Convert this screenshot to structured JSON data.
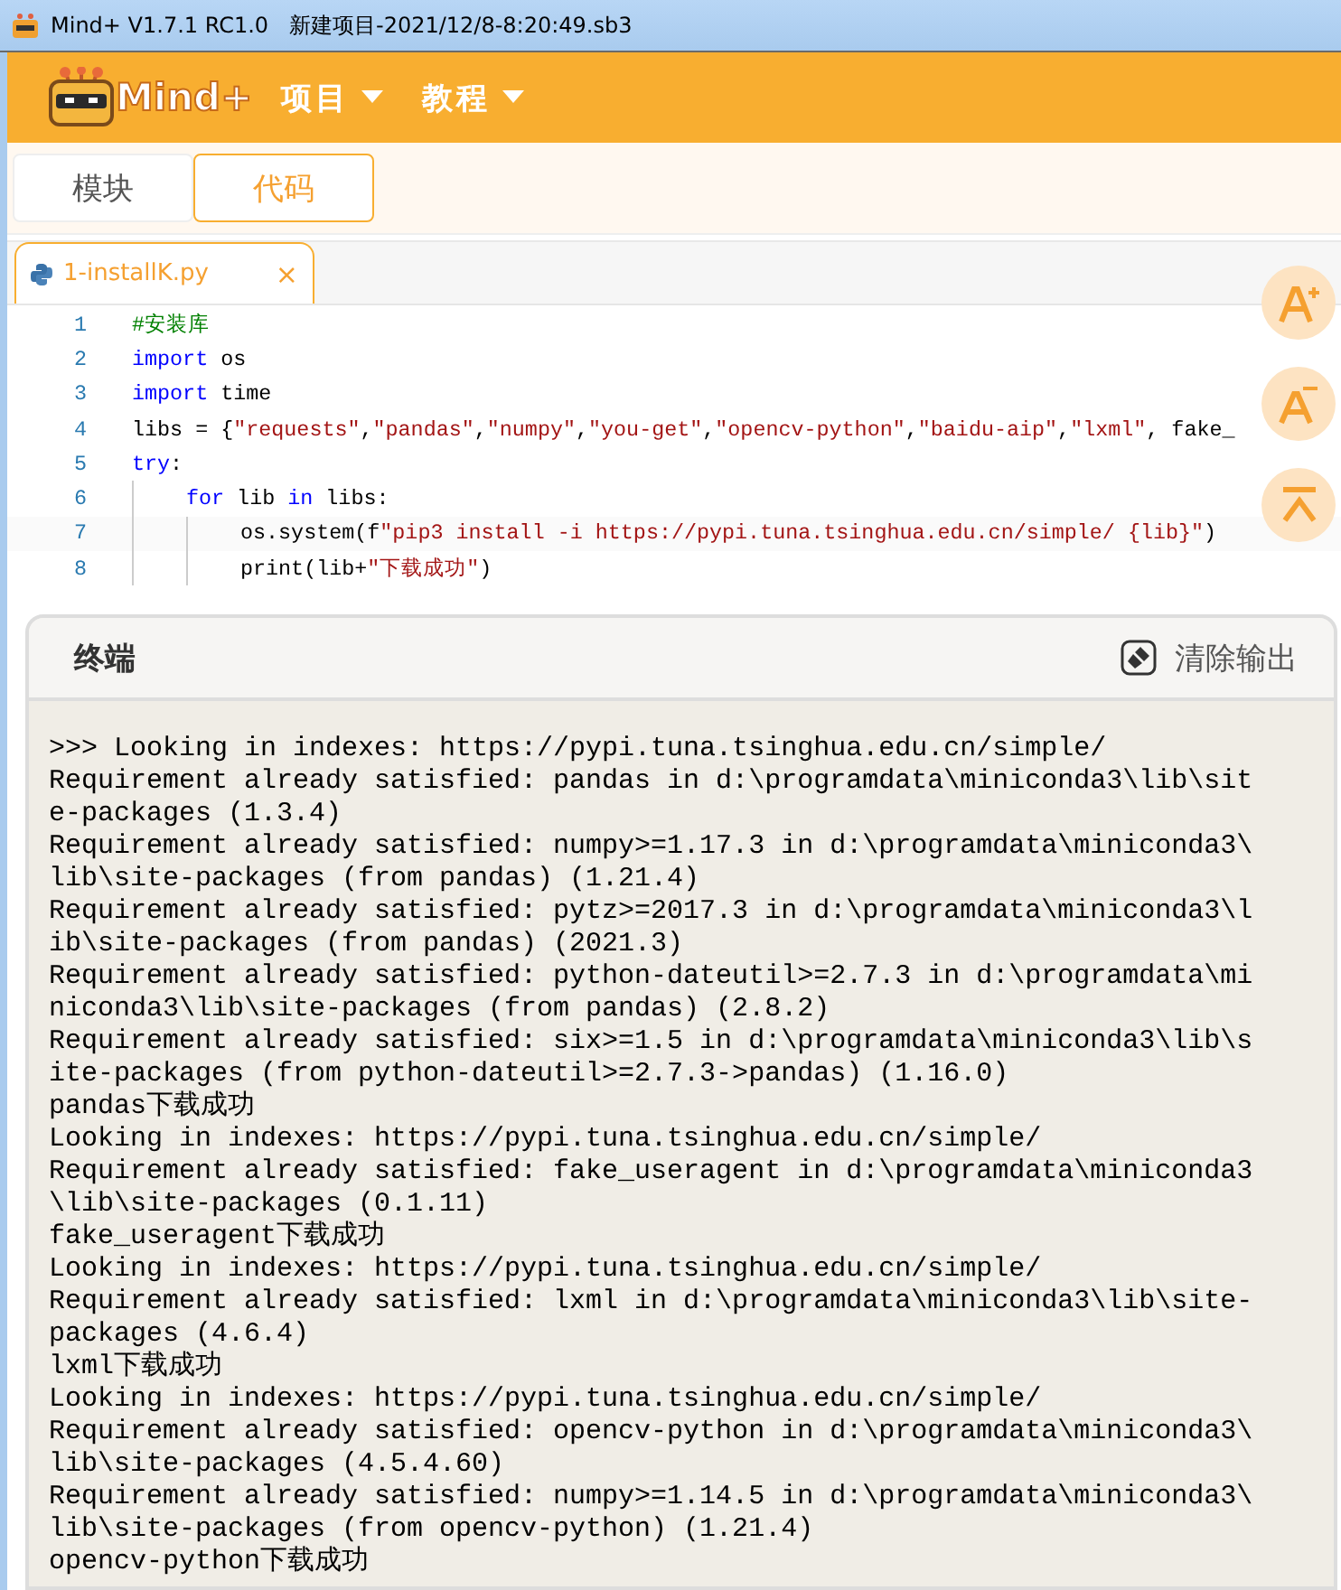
{
  "window": {
    "title": "Mind+ V1.7.1 RC1.0   新建项目-2021/12/8-8:20:49.sb3"
  },
  "header": {
    "logo": "Mind+",
    "menus": [
      {
        "label": "项目"
      },
      {
        "label": "教程"
      }
    ]
  },
  "mode_tabs": [
    {
      "label": "模块",
      "selected": false
    },
    {
      "label": "代码",
      "selected": true
    }
  ],
  "editor": {
    "file_tab": {
      "name": "1-installK.py",
      "close": "×"
    },
    "lines": [
      {
        "number": "1",
        "kind": "top",
        "tokens": [
          {
            "kind": "comment",
            "text": "#安装库"
          }
        ]
      },
      {
        "number": "2",
        "kind": "top",
        "tokens": [
          {
            "kind": "keyword",
            "text": "import"
          },
          {
            "kind": "plain",
            "text": " os"
          }
        ]
      },
      {
        "number": "3",
        "kind": "top",
        "tokens": [
          {
            "kind": "keyword",
            "text": "import"
          },
          {
            "kind": "plain",
            "text": " time"
          }
        ]
      },
      {
        "number": "4",
        "kind": "top",
        "tokens": [
          {
            "kind": "plain",
            "text": "libs = {"
          },
          {
            "kind": "string",
            "text": "\"requests\""
          },
          {
            "kind": "plain",
            "text": ","
          },
          {
            "kind": "string",
            "text": "\"pandas\""
          },
          {
            "kind": "plain",
            "text": ","
          },
          {
            "kind": "string",
            "text": "\"numpy\""
          },
          {
            "kind": "plain",
            "text": ","
          },
          {
            "kind": "string",
            "text": "\"you-get\""
          },
          {
            "kind": "plain",
            "text": ","
          },
          {
            "kind": "string",
            "text": "\"opencv-python\""
          },
          {
            "kind": "plain",
            "text": ","
          },
          {
            "kind": "string",
            "text": "\"baidu-aip\""
          },
          {
            "kind": "plain",
            "text": ","
          },
          {
            "kind": "string",
            "text": "\"lxml\""
          },
          {
            "kind": "plain",
            "text": ", fake_"
          }
        ]
      },
      {
        "number": "5",
        "kind": "top",
        "tokens": [
          {
            "kind": "keyword",
            "text": "try"
          },
          {
            "kind": "plain",
            "text": ":"
          }
        ]
      },
      {
        "number": "6",
        "kind": "block",
        "tokens": [
          {
            "kind": "keyword",
            "text": "for"
          },
          {
            "kind": "plain",
            "text": " lib "
          },
          {
            "kind": "keyword",
            "text": "in"
          },
          {
            "kind": "plain",
            "text": " libs:"
          }
        ]
      },
      {
        "number": "7",
        "kind": "nested",
        "tokens": [
          {
            "kind": "plain",
            "text": "os.system(f"
          },
          {
            "kind": "string",
            "text": "\"pip3 install -i https://pypi.tuna.tsinghua.edu.cn/simple/ {lib}\""
          },
          {
            "kind": "plain",
            "text": ")"
          }
        ]
      },
      {
        "number": "8",
        "kind": "nested",
        "tokens": [
          {
            "kind": "plain",
            "text": "print(lib+"
          },
          {
            "kind": "string",
            "text": "\"下载成功\""
          },
          {
            "kind": "plain",
            "text": ")"
          }
        ]
      }
    ],
    "side_buttons": [
      {
        "kind": "font-up"
      },
      {
        "kind": "font-down"
      },
      {
        "kind": "to-top"
      }
    ]
  },
  "terminal": {
    "title": "终端",
    "clear_button": "清除输出",
    "lines": [
      ">>> Looking in indexes: https://pypi.tuna.tsinghua.edu.cn/simple/",
      "Requirement already satisfied: pandas in d:\\programdata\\miniconda3\\lib\\sit",
      "e-packages (1.3.4)",
      "Requirement already satisfied: numpy>=1.17.3 in d:\\programdata\\miniconda3\\",
      "lib\\site-packages (from pandas) (1.21.4)",
      "Requirement already satisfied: pytz>=2017.3 in d:\\programdata\\miniconda3\\l",
      "ib\\site-packages (from pandas) (2021.3)",
      "Requirement already satisfied: python-dateutil>=2.7.3 in d:\\programdata\\mi",
      "niconda3\\lib\\site-packages (from pandas) (2.8.2)",
      "Requirement already satisfied: six>=1.5 in d:\\programdata\\miniconda3\\lib\\s",
      "ite-packages (from python-dateutil>=2.7.3->pandas) (1.16.0)",
      "pandas下载成功",
      "Looking in indexes: https://pypi.tuna.tsinghua.edu.cn/simple/",
      "Requirement already satisfied: fake_useragent in d:\\programdata\\miniconda3",
      "\\lib\\site-packages (0.1.11)",
      "fake_useragent下载成功",
      "Looking in indexes: https://pypi.tuna.tsinghua.edu.cn/simple/",
      "Requirement already satisfied: lxml in d:\\programdata\\miniconda3\\lib\\site-",
      "packages (4.6.4)",
      "lxml下载成功",
      "Looking in indexes: https://pypi.tuna.tsinghua.edu.cn/simple/",
      "Requirement already satisfied: opencv-python in d:\\programdata\\miniconda3\\",
      "lib\\site-packages (4.5.4.60)",
      "Requirement already satisfied: numpy>=1.14.5 in d:\\programdata\\miniconda3\\",
      "lib\\site-packages (from opencv-python) (1.21.4)",
      "opencv-python下载成功"
    ]
  }
}
